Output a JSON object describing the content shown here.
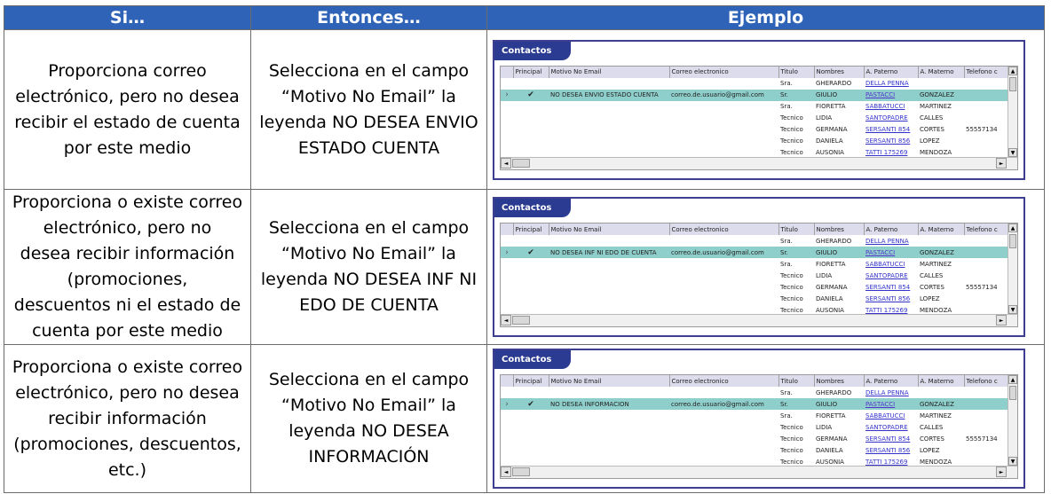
{
  "headers": {
    "si": "Si…",
    "entonces": "Entonces…",
    "ejemplo": "Ejemplo"
  },
  "rows": [
    {
      "si_lines": [
        "Proporciona correo",
        "electrónico, pero no desea",
        "recibir el estado de cuenta",
        "por este medio"
      ],
      "entonces_lines": [
        "Selecciona en el campo",
        "“Motivo No Email” la",
        "leyenda NO DESEA ENVIO",
        "ESTADO CUENTA"
      ],
      "motivo": "NO DESEA ENVIO ESTADO CUENTA"
    },
    {
      "si_lines": [
        "Proporciona o existe correo",
        "electrónico, pero no",
        "desea recibir información",
        "(promociones,",
        "descuentos ni el estado de",
        "cuenta por este medio"
      ],
      "entonces_lines": [
        "Selecciona en el campo",
        "“Motivo No Email” la",
        "leyenda NO DESEA INF NI",
        "EDO DE CUENTA"
      ],
      "motivo": "NO DESEA INF NI EDO DE CUENTA"
    },
    {
      "si_lines": [
        "Proporciona o existe correo",
        "electrónico, pero no desea",
        "recibir información",
        "(promociones, descuentos,",
        "etc.)"
      ],
      "entonces_lines": [
        "Selecciona en el campo",
        "“Motivo No Email” la",
        "leyenda NO DESEA",
        "INFORMACIÓN"
      ],
      "motivo": "NO DESEA INFORMACION"
    }
  ],
  "widget": {
    "tab": "Contactos",
    "columns": [
      "Principal",
      "Motivo No Email",
      "Correo electronico",
      "Titulo",
      "Nombres",
      "A. Paterno",
      "A. Materno",
      "Telefono c"
    ],
    "email": "correo.de.usuario@gmail.com",
    "check": "✔",
    "arrow": "›",
    "contacts": [
      {
        "titulo": "Sra.",
        "nombres": "GHERARDO",
        "paterno": "DELLA PENNA",
        "materno": "",
        "telefono": ""
      },
      {
        "titulo": "Sr.",
        "nombres": "GIULIO",
        "paterno": "PASTACCI",
        "materno": "GONZALEZ",
        "telefono": ""
      },
      {
        "titulo": "Sra.",
        "nombres": "FIORETTA",
        "paterno": "SABBATUCCI",
        "materno": "MARTINEZ",
        "telefono": ""
      },
      {
        "titulo": "Tecnico",
        "nombres": "LIDIA",
        "paterno": "SANTOPADRE",
        "materno": "CALLES",
        "telefono": ""
      },
      {
        "titulo": "Tecnico",
        "nombres": "GERMANA",
        "paterno": "SERSANTI 854",
        "materno": "CORTES",
        "telefono": "55557134"
      },
      {
        "titulo": "Tecnico",
        "nombres": "DANIELA",
        "paterno": "SERSANTI 856",
        "materno": "LOPEZ",
        "telefono": ""
      },
      {
        "titulo": "Tecnico",
        "nombres": "AUSONIA",
        "paterno": "TATTI 175269",
        "materno": "MENDOZA",
        "telefono": ""
      }
    ],
    "scroll": {
      "up": "▲",
      "down": "▼",
      "left": "◄",
      "right": "►"
    }
  },
  "colors": {
    "header_bg": "#2f63b8",
    "tab_bg": "#2a3b91",
    "selected_row": "#8fcfcb"
  }
}
